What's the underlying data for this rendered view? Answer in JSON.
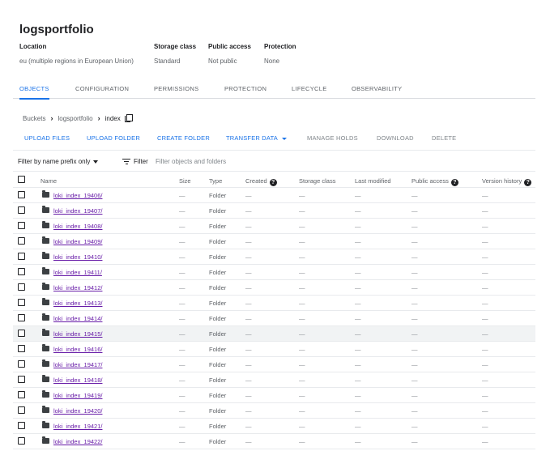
{
  "bucket": {
    "name": "logsportfolio",
    "meta": [
      {
        "label": "Location",
        "value": "eu (multiple regions in European Union)"
      },
      {
        "label": "Storage class",
        "value": "Standard"
      },
      {
        "label": "Public access",
        "value": "Not public"
      },
      {
        "label": "Protection",
        "value": "None"
      }
    ]
  },
  "tabs": [
    {
      "label": "OBJECTS",
      "active": true
    },
    {
      "label": "CONFIGURATION"
    },
    {
      "label": "PERMISSIONS"
    },
    {
      "label": "PROTECTION"
    },
    {
      "label": "LIFECYCLE"
    },
    {
      "label": "OBSERVABILITY"
    }
  ],
  "breadcrumb": {
    "root": "Buckets",
    "bucket": "logsportfolio",
    "current": "index"
  },
  "actions": {
    "upload_files": "UPLOAD FILES",
    "upload_folder": "UPLOAD FOLDER",
    "create_folder": "CREATE FOLDER",
    "transfer_data": "TRANSFER DATA",
    "manage_holds": "MANAGE HOLDS",
    "download": "DOWNLOAD",
    "delete": "DELETE"
  },
  "filter": {
    "mode": "Filter by name prefix only",
    "label": "Filter",
    "placeholder": "Filter objects and folders"
  },
  "table": {
    "columns": {
      "name": "Name",
      "size": "Size",
      "type": "Type",
      "created": "Created",
      "storage_class": "Storage class",
      "last_modified": "Last modified",
      "public_access": "Public access",
      "version_history": "Version history"
    },
    "empty_value": "—",
    "rows": [
      {
        "name": "loki_index_19406/",
        "type": "Folder"
      },
      {
        "name": "loki_index_19407/",
        "type": "Folder"
      },
      {
        "name": "loki_index_19408/",
        "type": "Folder"
      },
      {
        "name": "loki_index_19409/",
        "type": "Folder"
      },
      {
        "name": "loki_index_19410/",
        "type": "Folder"
      },
      {
        "name": "loki_index_19411/",
        "type": "Folder"
      },
      {
        "name": "loki_index_19412/",
        "type": "Folder"
      },
      {
        "name": "loki_index_19413/",
        "type": "Folder"
      },
      {
        "name": "loki_index_19414/",
        "type": "Folder"
      },
      {
        "name": "loki_index_19415/",
        "type": "Folder",
        "highlighted": true
      },
      {
        "name": "loki_index_19416/",
        "type": "Folder"
      },
      {
        "name": "loki_index_19417/",
        "type": "Folder"
      },
      {
        "name": "loki_index_19418/",
        "type": "Folder"
      },
      {
        "name": "loki_index_19419/",
        "type": "Folder"
      },
      {
        "name": "loki_index_19420/",
        "type": "Folder"
      },
      {
        "name": "loki_index_19421/",
        "type": "Folder"
      },
      {
        "name": "loki_index_19422/",
        "type": "Folder"
      }
    ]
  },
  "colors": {
    "accent": "#1a73e8",
    "link_visited": "#681da8",
    "muted": "#5f6368",
    "disabled": "#80868b",
    "row_highlight": "#f1f3f4"
  }
}
